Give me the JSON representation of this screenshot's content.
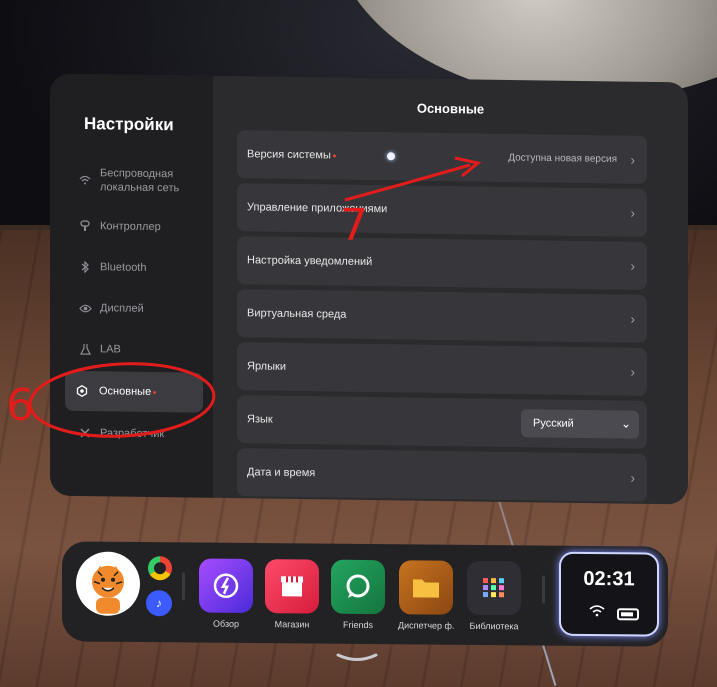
{
  "sidebar": {
    "title": "Настройки",
    "items": [
      {
        "label": "Беспроводная локальная сеть",
        "icon": "wifi-icon"
      },
      {
        "label": "Контроллер",
        "icon": "controller-icon"
      },
      {
        "label": "Bluetooth",
        "icon": "bluetooth-icon"
      },
      {
        "label": "Дисплей",
        "icon": "eye-icon"
      },
      {
        "label": "LAB",
        "icon": "flask-icon"
      },
      {
        "label": "Основные",
        "icon": "gear-icon",
        "active": true
      },
      {
        "label": "Разработчик",
        "icon": "tools-icon"
      }
    ]
  },
  "main": {
    "title": "Основные",
    "rows": [
      {
        "label": "Версия системы",
        "value": "Доступна новая версия"
      },
      {
        "label": "Управление приложениями"
      },
      {
        "label": "Настройка уведомлений"
      },
      {
        "label": "Виртуальная среда"
      },
      {
        "label": "Ярлыки"
      },
      {
        "label": "Язык",
        "select": "Русский"
      },
      {
        "label": "Дата и время"
      }
    ]
  },
  "annotations": {
    "left_number": "6",
    "right_number": "7"
  },
  "dock": {
    "apps": [
      {
        "label": "Обзор",
        "color": "#7a3cf0"
      },
      {
        "label": "Магазин",
        "color": "#e8344e"
      },
      {
        "label": "Friends",
        "color": "#1d8a4a"
      },
      {
        "label": "Диспетчер ф...",
        "color": "#b5651d"
      },
      {
        "label": "Библиотека",
        "color": "#2a2a30"
      }
    ],
    "time": "02:31"
  },
  "colors": {
    "accent_red": "#e0403a",
    "annotation_red": "#e21b1b",
    "panel_bg": "#2b2b2e",
    "sidebar_bg": "#1f1f22"
  }
}
